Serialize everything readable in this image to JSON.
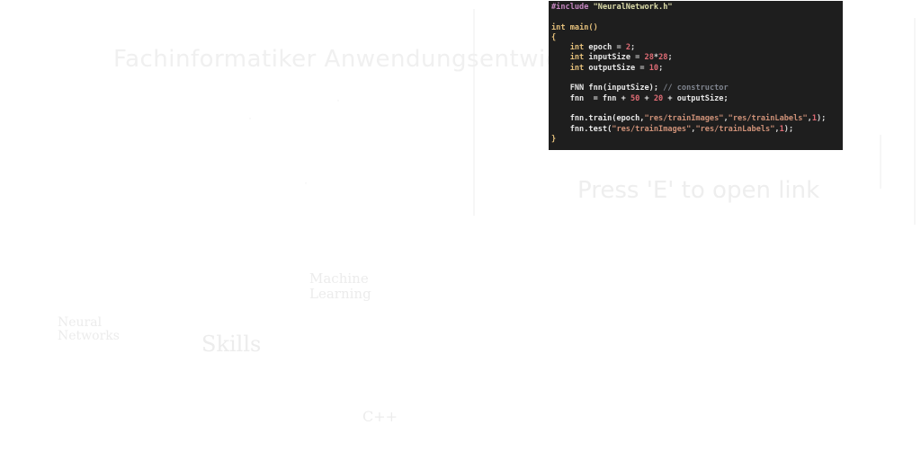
{
  "scene": {
    "title": "Fachinformatiker Anwendungsentwicklung",
    "prompt": "Press 'E' to open link",
    "skills_label": "Skills",
    "machine_learning_label": "Machine Learning",
    "neural_networks_label": "Neural Networks",
    "cpp_label": "C++"
  },
  "code": {
    "include_kw": "#include",
    "include_file": "\"NeuralNetwork.h\"",
    "main_type": "int",
    "main_name": "main",
    "main_parens": "()",
    "open_brace": "{",
    "close_brace": "}",
    "int_kw": "int",
    "epoch_name": "epoch",
    "epoch_value": "2",
    "inputsize_name": "inputSize",
    "inputsize_value_a": "28",
    "inputsize_op": "*",
    "inputsize_value_b": "28",
    "outputsize_name": "outputSize",
    "outputsize_value": "10",
    "fnn_type": "FNN",
    "fnn_ctor": "fnn(inputSize);",
    "comment": "// constructor",
    "fnn_assign_a": "fnn  = fnn + ",
    "layer_a": "50",
    "plus": " + ",
    "layer_b": "20",
    "fnn_assign_tail": " + outputSize;",
    "train_call": "fnn.train(epoch,",
    "train_images": "\"res/trainImages\"",
    "comma": ",",
    "train_labels": "\"res/trainLabels\"",
    "train_one": "1",
    "call_end": ");",
    "test_call": "fnn.test(",
    "test_images": "\"res/trainImages\"",
    "test_labels": "\"res/trainLabels\"",
    "test_one": "1"
  },
  "colors": {
    "background": "#ffffff",
    "code_bg": "#1e1e1e",
    "preprocessor": "#c586c0",
    "string": "#ce9178",
    "keyword": "#e5c07b",
    "number": "#e06c75",
    "comment": "#7f848e"
  }
}
